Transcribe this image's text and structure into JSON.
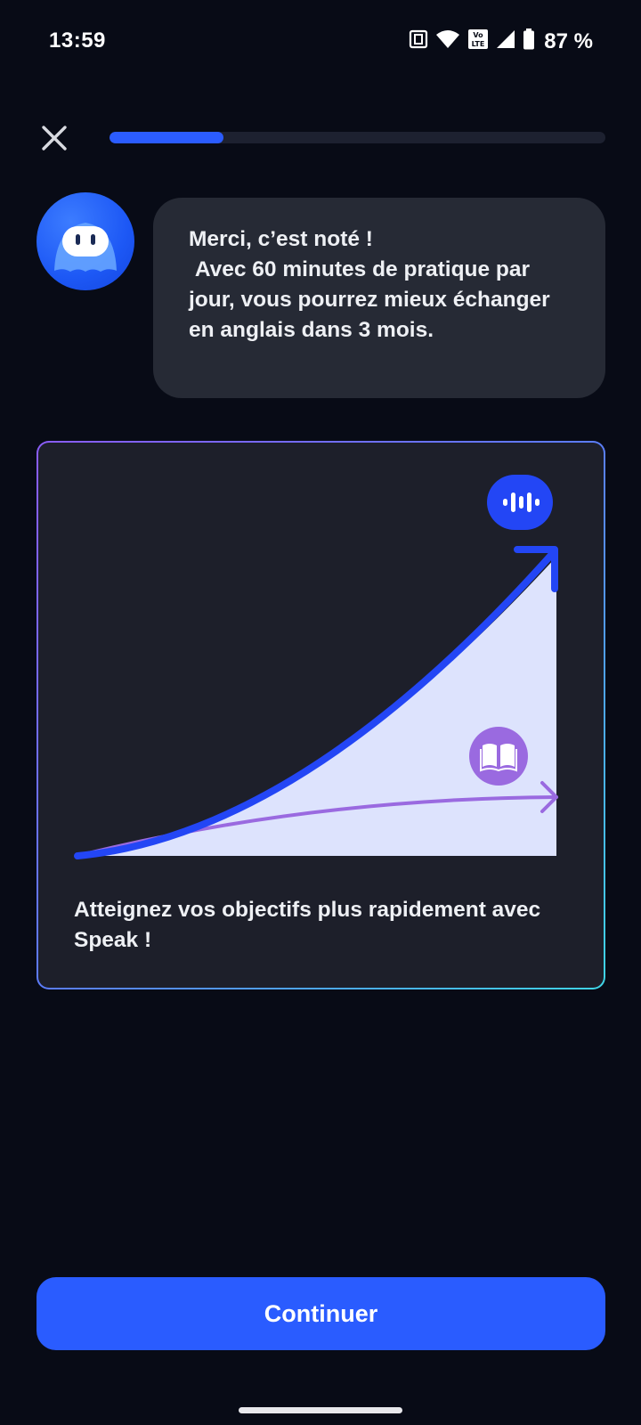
{
  "status_bar": {
    "time": "13:59",
    "battery": "87 %",
    "icons": [
      "nfc-icon",
      "wifi-icon",
      "volte-icon",
      "signal-icon",
      "battery-icon"
    ]
  },
  "top_bar": {
    "close_icon": "close-icon",
    "progress": 0.23
  },
  "chat": {
    "avatar_icon": "speak-mascot-avatar",
    "message": "Merci, c’est noté !\n Avec 60 minutes de pratique par jour, vous pourrez mieux échanger en anglais dans 3 mois."
  },
  "card": {
    "caption": "Atteignez vos objectifs plus rapidement avec Speak !",
    "top_badge_icon": "voice-wave-icon",
    "bottom_badge_icon": "open-book-icon"
  },
  "colors": {
    "accent": "#2a5cff",
    "secondary": "#9a6ae0",
    "chart_fill": "#dde3fd",
    "background": "#080b16",
    "bubble": "#262a35",
    "card": "#1d1f2a"
  },
  "continue_button": {
    "label": "Continuer"
  }
}
